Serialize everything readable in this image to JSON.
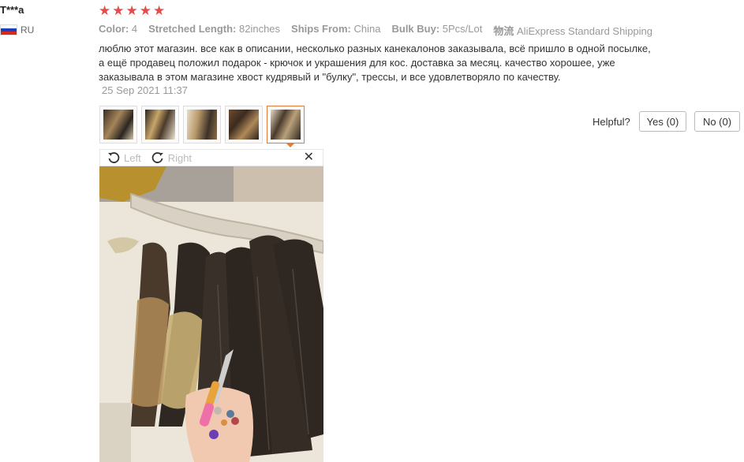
{
  "reviewer": {
    "name": "T***a",
    "country_code": "RU"
  },
  "rating": {
    "stars": 5,
    "star_glyph": "★"
  },
  "properties": [
    {
      "key": "Color:",
      "value": "4"
    },
    {
      "key": "Stretched Length:",
      "value": "82inches"
    },
    {
      "key": "Ships From:",
      "value": "China"
    },
    {
      "key": "Bulk Buy:",
      "value": "5Pcs/Lot"
    },
    {
      "key": "物流",
      "value": "AliExpress Standard Shipping"
    }
  ],
  "review_text": "люблю этот магазин. все как в описании, несколько разных канекалонов заказывала, всё пришло в одной посылке, а ещё продавец положил подарок - крючок и украшения для кос. доставка за месяц. качество хорошее, уже заказывала в этом магазине хвост кудрявый и \"булку\", трессы, и все удовлетворяло по качеству.",
  "review_date": "25 Sep 2021 11:37",
  "thumbnails": {
    "count": 5,
    "active_index": 4
  },
  "helpful": {
    "label": "Helpful?",
    "yes_label": "Yes (0)",
    "no_label": "No (0)"
  },
  "viewer": {
    "rotate_left_label": "Left",
    "rotate_right_label": "Right",
    "close_glyph": "✕"
  },
  "colors": {
    "star": "#e64a4a",
    "active_thumb_border": "#e07b3a",
    "muted_text": "#999999"
  }
}
